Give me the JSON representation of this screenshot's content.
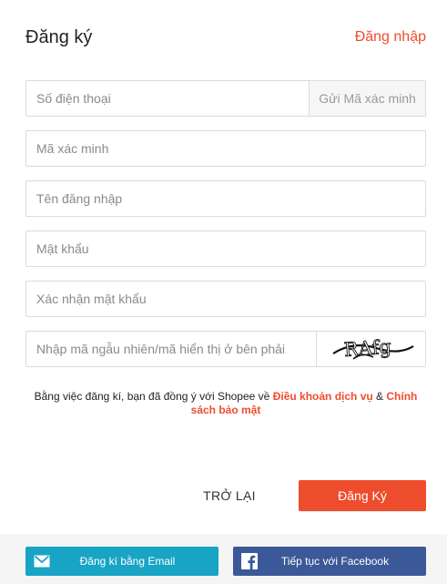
{
  "header": {
    "title": "Đăng ký",
    "login_link": "Đăng nhập"
  },
  "form": {
    "phone_placeholder": "Số điện thoại",
    "send_code_label": "Gửi Mã xác minh",
    "code_placeholder": "Mã xác minh",
    "username_placeholder": "Tên đăng nhập",
    "password_placeholder": "Mật khẩu",
    "confirm_password_placeholder": "Xác nhận mật khẩu",
    "captcha_placeholder": "Nhập mã ngẫu nhiên/mã hiển thị ở bên phải",
    "captcha_text": "RAfg"
  },
  "terms": {
    "prefix": "Bằng việc đăng kí, bạn đã đồng ý với Shopee về ",
    "service_link": "Điều khoản dịch vụ",
    "joiner": " & ",
    "privacy_link": "Chính sách bảo mật"
  },
  "actions": {
    "back_label": "TRỞ LẠI",
    "submit_label": "Đăng Ký"
  },
  "social": {
    "email_label": "Đăng kí bằng Email",
    "facebook_label": "Tiếp tục với Facebook"
  },
  "colors": {
    "accent": "#ee4d2d",
    "email": "#18a4c4",
    "facebook": "#3b5998"
  }
}
